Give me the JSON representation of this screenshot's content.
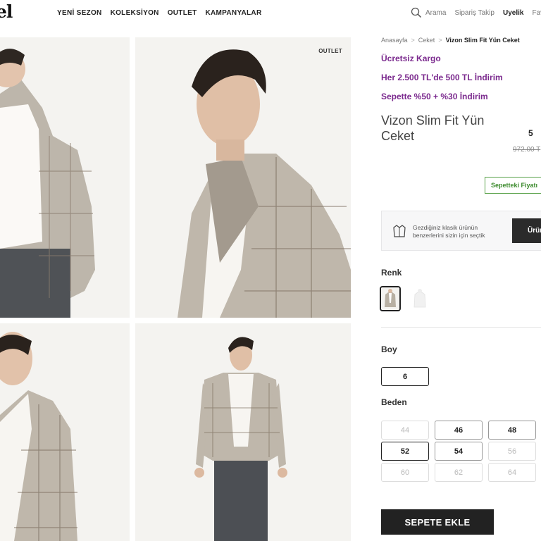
{
  "header": {
    "logo_text": "el",
    "nav": [
      "YENİ SEZON",
      "KOLEKSİYON",
      "OUTLET",
      "KAMPANYALAR"
    ],
    "search_label": "Arama",
    "order_tracking": "Sipariş Takip",
    "membership": "Uyelik",
    "favorites": "Fav"
  },
  "gallery": {
    "badge": "OUTLET"
  },
  "breadcrumb": [
    "Anasayfa",
    "Ceket",
    "Vizon Slim Fit Yün Ceket"
  ],
  "promos": [
    "Ücretsiz Kargo",
    "Her 2.500 TL'de 500 TL İndirim",
    "Sepette %50 + %30 İndirim"
  ],
  "product": {
    "title": "Vizon Slim Fit Yün Ceket",
    "price_partial": "5",
    "old_price": "972.00 T",
    "basket_price_label": "Sepetteki Fiyatı"
  },
  "suggestion": {
    "text": "Gezdiğiniz klasik ürünün benzerlerini sizin için seçtik",
    "button": "Ürün"
  },
  "color": {
    "label": "Renk",
    "options": [
      "Vizon",
      "Beyaz"
    ]
  },
  "boy": {
    "label": "Boy",
    "options": [
      {
        "value": "6",
        "selected": true
      }
    ]
  },
  "beden": {
    "label": "Beden",
    "sizes": [
      {
        "value": "44",
        "available": false
      },
      {
        "value": "46",
        "available": true
      },
      {
        "value": "48",
        "available": true
      },
      {
        "value": "52",
        "available": true,
        "selected": true
      },
      {
        "value": "54",
        "available": true
      },
      {
        "value": "56",
        "available": false
      },
      {
        "value": "60",
        "available": false
      },
      {
        "value": "62",
        "available": false
      },
      {
        "value": "64",
        "available": false
      }
    ]
  },
  "cart": {
    "add_label": "SEPETE EKLE"
  },
  "colors": {
    "promo": "#7b2a8e",
    "basket_green": "#3b8a2c",
    "button_dark": "#222222"
  }
}
